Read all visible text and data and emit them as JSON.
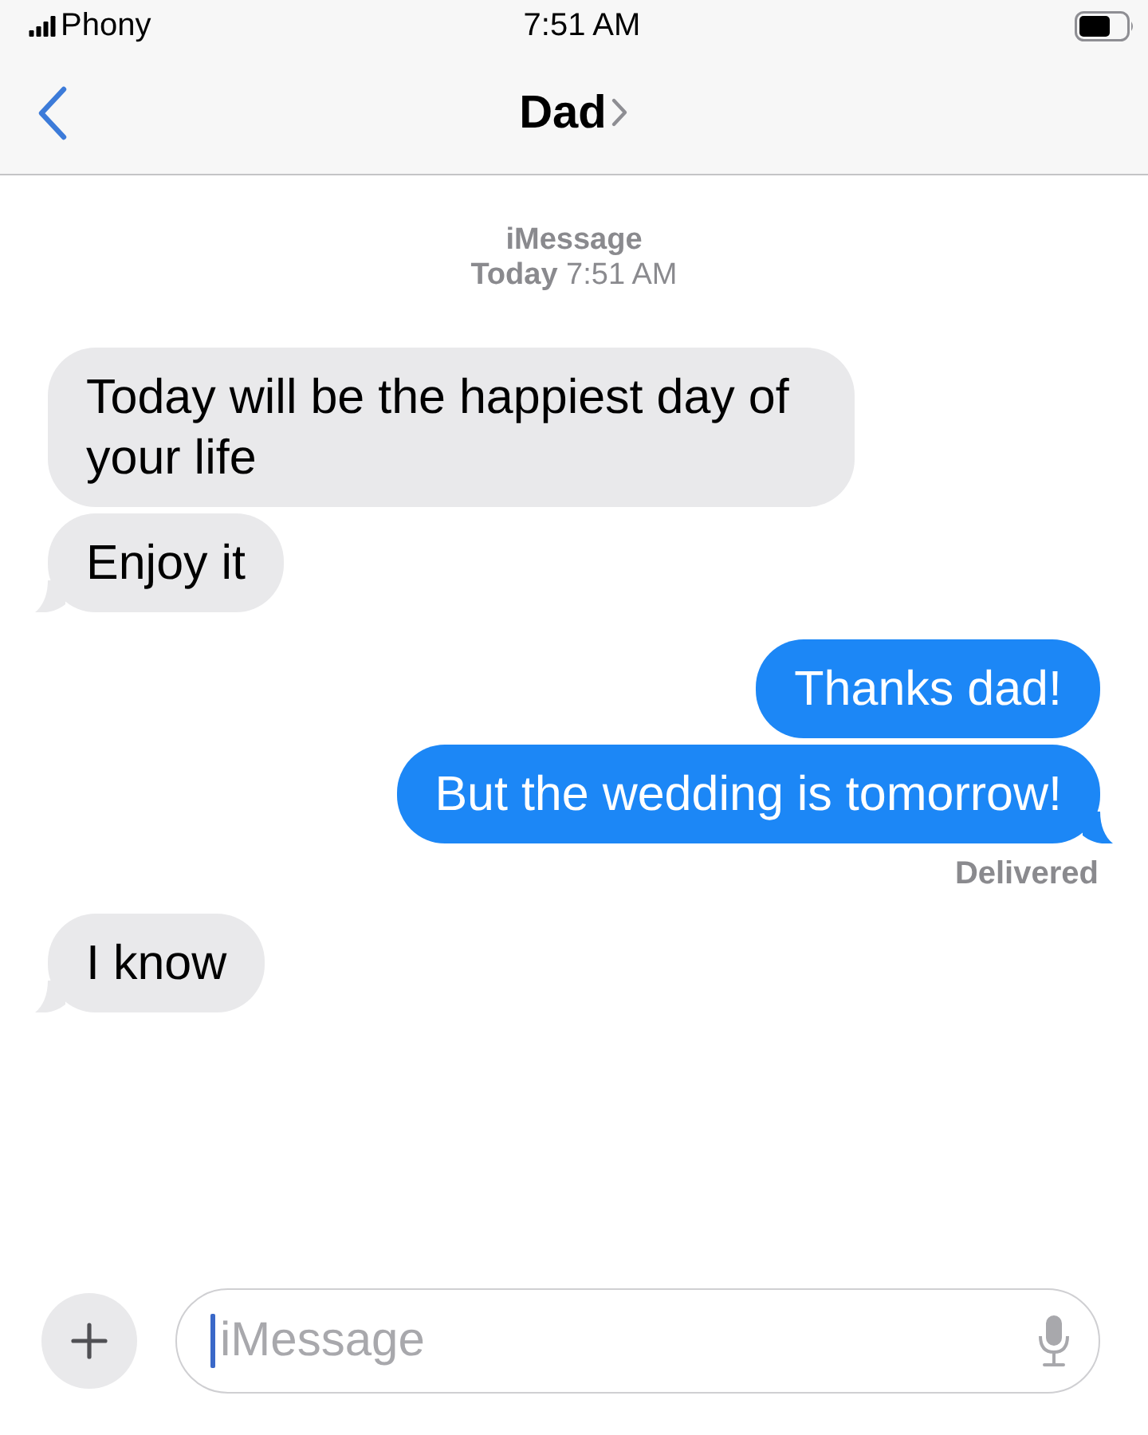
{
  "status_bar": {
    "carrier": "Phony",
    "time": "7:51 AM"
  },
  "nav": {
    "title": "Dad"
  },
  "thread_header": {
    "service": "iMessage",
    "timestamp": "**Today** 7:51 AM"
  },
  "messages": [
    {
      "kind": "received",
      "text": "Today will be the happiest day of your life",
      "tail": false
    },
    {
      "kind": "received",
      "text": "Enjoy it",
      "tail": true
    },
    {
      "kind": "sent",
      "text": "Thanks dad!",
      "tail": false
    },
    {
      "kind": "sent",
      "text": "But the wedding is tomorrow!",
      "tail": true,
      "status": "Delivered"
    },
    {
      "kind": "received",
      "text": "I know",
      "tail": true
    }
  ],
  "composer": {
    "placeholder": "iMessage",
    "focused": true
  }
}
